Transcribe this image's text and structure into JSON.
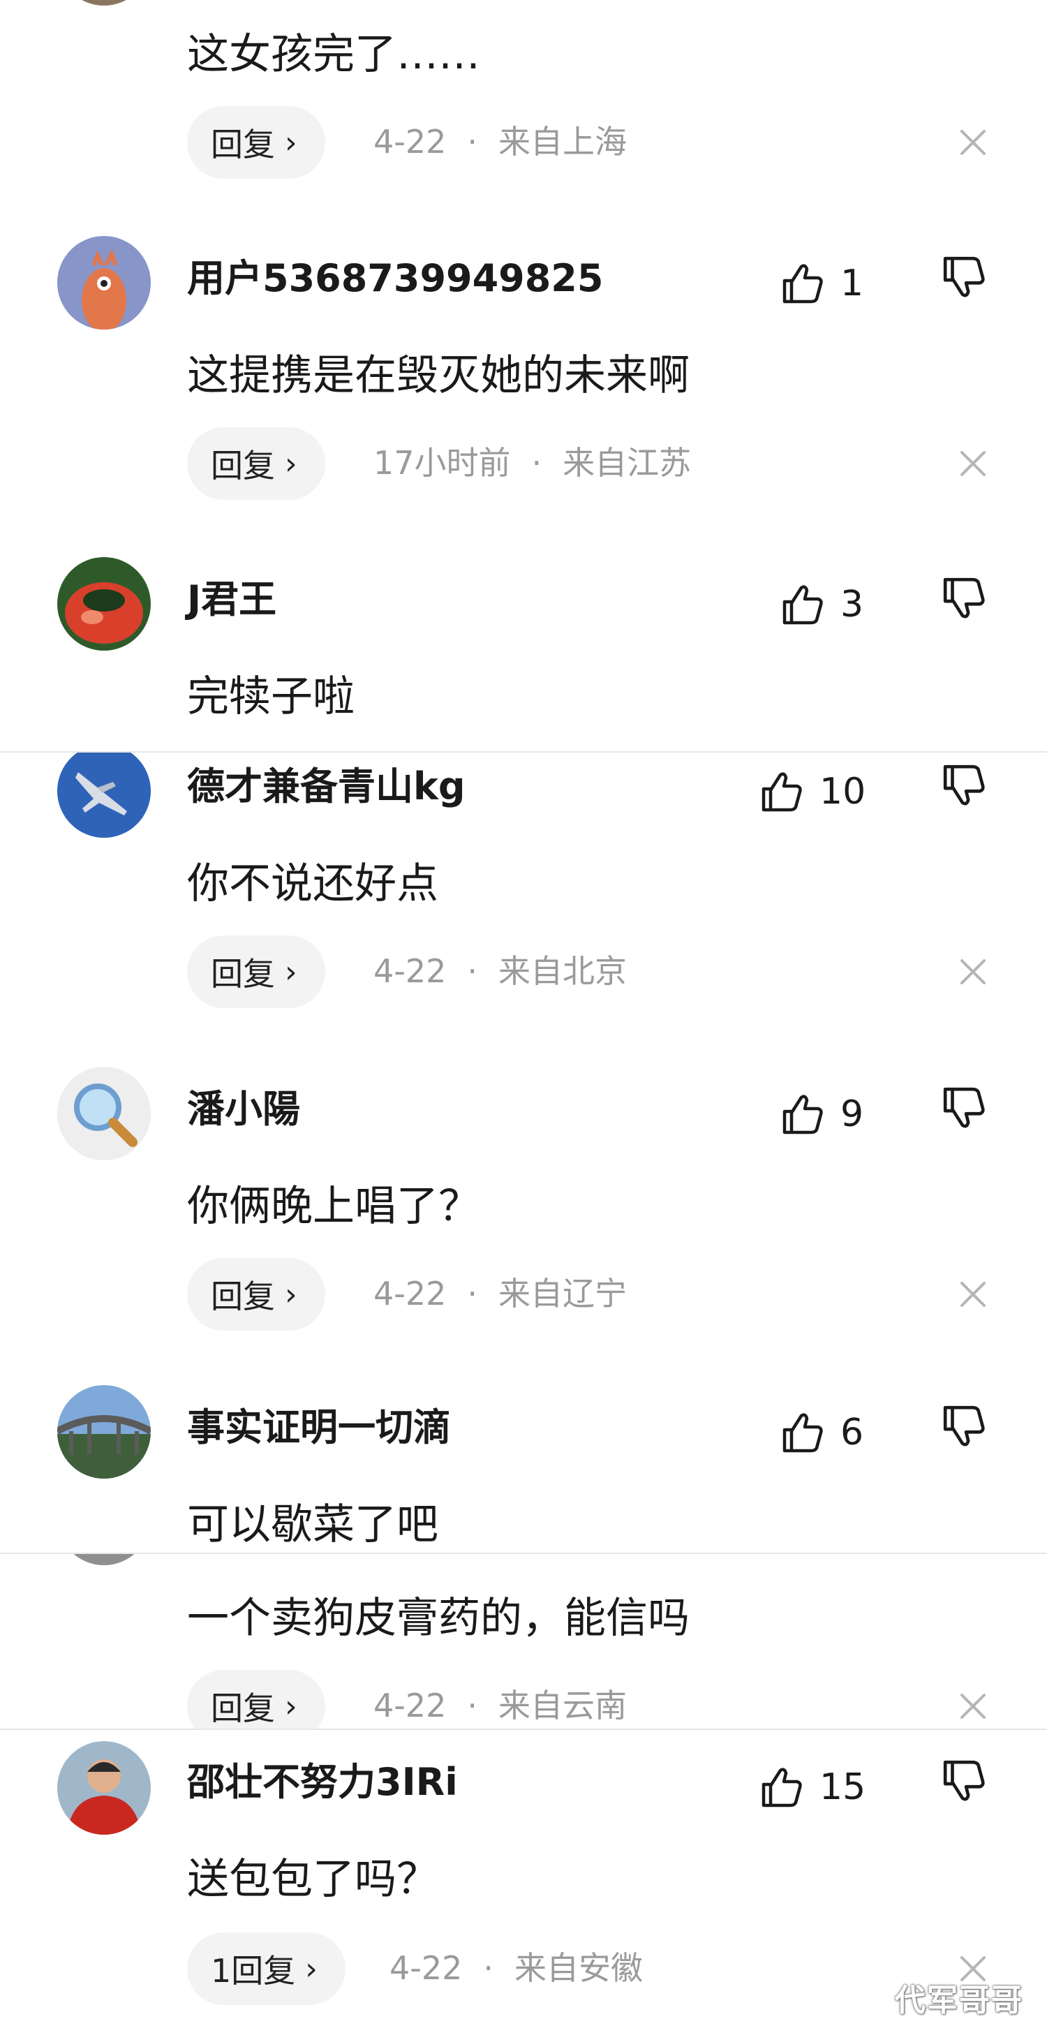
{
  "reply_label": "回复",
  "comments": [
    {
      "text": "这女孩完了……",
      "date": "4-22",
      "location": "来自上海"
    },
    {
      "user": "用户5368739949825",
      "likes": "1",
      "text": "这提携是在毁灭她的未来啊",
      "date": "17小时前",
      "location": "来自江苏"
    },
    {
      "user": "J君王",
      "likes": "3",
      "text": "完犊子啦"
    },
    {
      "user": "德才兼备青山kg",
      "likes": "10",
      "text": "你不说还好点",
      "date": "4-22",
      "location": "来自北京"
    },
    {
      "user": "潘小陽",
      "likes": "9",
      "text": "你俩晚上唱了？",
      "date": "4-22",
      "location": "来自辽宁"
    },
    {
      "user": "事实证明一切滴",
      "likes": "6",
      "text": "可以歇菜了吧"
    },
    {
      "text": "一个卖狗皮膏药的，能信吗",
      "date": "4-22",
      "location": "来自云南"
    },
    {
      "user": "邵壮不努力3IRi",
      "likes": "15",
      "text": "送包包了吗？",
      "reply_label": "1回复",
      "date": "4-22",
      "location": "来自安徽"
    }
  ],
  "watermark": "代军哥哥",
  "colors": {
    "meta_gray": "#9a9a9a",
    "reply_bg": "#f3f3f3",
    "text": "#1a1a1a"
  },
  "icons": [
    "thumbs-up-icon",
    "thumbs-down-icon",
    "close-icon",
    "chevron-right-icon"
  ]
}
